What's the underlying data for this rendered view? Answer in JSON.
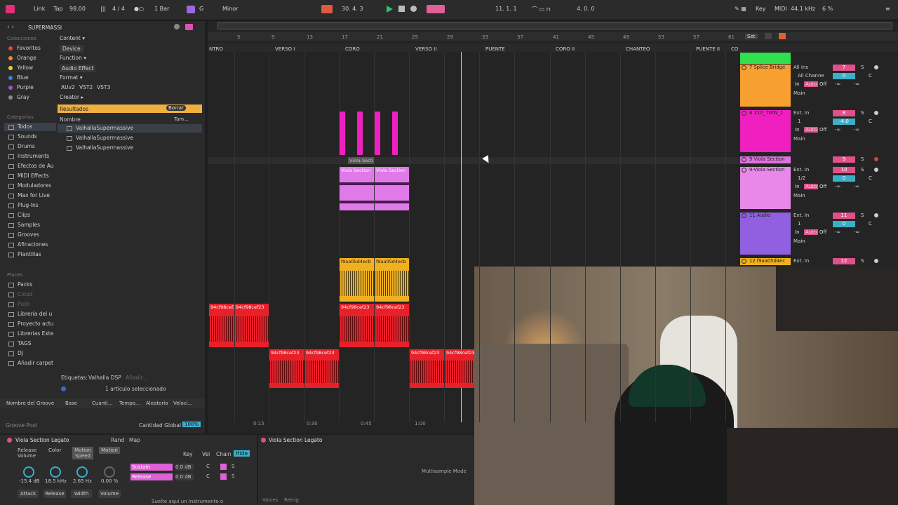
{
  "topbar": {
    "link": "Link",
    "tap": "Tap",
    "tempo": "98.00",
    "signature": "4 / 4",
    "quant": "1 Bar",
    "key_root": "G",
    "scale": "Minor",
    "pos1": "30.  4.  3",
    "pos2": "11.  1.  1",
    "pos3": "4.  0.  0",
    "key_btn": "Key",
    "midi_btn": "MIDI",
    "sample_rate": "44.1 kHz",
    "cpu": "6 %"
  },
  "browser": {
    "search": "SUPERMASSI",
    "colecciones_title": "Colecciones",
    "collections": [
      {
        "label": "Favoritos",
        "color": "#e04545"
      },
      {
        "label": "Orange",
        "color": "#f08a2a"
      },
      {
        "label": "Yellow",
        "color": "#e8d430"
      },
      {
        "label": "Blue",
        "color": "#3f7fe0"
      },
      {
        "label": "Purple",
        "color": "#9a55d8"
      },
      {
        "label": "Gray",
        "color": "#8a8a8a"
      }
    ],
    "categorias_title": "Categorías",
    "categories": [
      "Todos",
      "Sounds",
      "Drums",
      "Instruments",
      "Efectos de Au",
      "MIDI Effects",
      "Moduladores",
      "Max for Live",
      "Plug-Ins",
      "Clips",
      "Samples",
      "Grooves",
      "Afinaciones",
      "Plantillas"
    ],
    "places_title": "Places",
    "places": [
      "Packs",
      "Cloud",
      "Push",
      "Librería del u",
      "Proyecto actu",
      "Librerias Exte",
      "TAGS",
      "DJ",
      "Añadir carpet"
    ],
    "filters": {
      "content": "Content ▾",
      "device": "Device",
      "function": "Function ▾",
      "audio_effect": "Audio Effect",
      "format": "Format ▾",
      "formats": [
        "AUv2",
        "VST2",
        "VST3"
      ],
      "creator": "Creator ▸"
    },
    "results_label": "Resultados",
    "clear_btn": "Borrar",
    "col_name": "Nombre",
    "col_size": "Tam...",
    "results": [
      "ValhallaSupermassive",
      "ValhallaSupermassive",
      "ValhallaSupermassive"
    ],
    "tags_label": "Etiquetas:",
    "tag_value": "Valhalla DSP",
    "add_tag": "Añadir...",
    "selected_info": "1 artículo seleccionado",
    "groove_headers": [
      "Nombre del Groove",
      "Base",
      "Cuanti...",
      "Tempo...",
      "Aleatorio",
      "Veloci..."
    ],
    "groove_pool": "Groove Pool",
    "global_amount_label": "Cantidad Global",
    "global_amount": "100%"
  },
  "arrangement": {
    "ruler": [
      "5",
      "9",
      "13",
      "17",
      "21",
      "25",
      "29",
      "33",
      "37",
      "41",
      "45",
      "49",
      "53",
      "57",
      "61"
    ],
    "locators": [
      "NTRO",
      "VERSO I",
      "CORO",
      "VERSO II",
      "PUENTE",
      "CORO II",
      "CHANTEO",
      "PUENTE II",
      "CO"
    ],
    "set_label": "Set",
    "timeline": [
      "0:15",
      "0:30",
      "0:45",
      "1:00"
    ],
    "clip_labels": {
      "viola_small": "Viola Secti",
      "viola_1": "Viola Section",
      "viola_2": "Viola Section",
      "yellow_1": "f9aa05d4ecb",
      "yellow_2": "f9aa05d4ecb",
      "red_a1": "94cf98cef23",
      "red_a2": "94cf98cef23",
      "red_b1": "94cf98cef23",
      "red_b2": "94cf98cef23",
      "red_c1": "94cf98cef23",
      "red_c2": "94cf98cef23",
      "red_d1": "94cf98cef23",
      "red_d2": "94cf98cef23"
    },
    "tracks": [
      {
        "name": "7 Splice Bridge",
        "color": "#f7a030",
        "in": "All Ins",
        "ch": "All Channe",
        "num": "7",
        "out": "Main",
        "vol": "0",
        "pan": "C"
      },
      {
        "name": "8 X10_TWW_1",
        "color": "#f020c0",
        "in": "Ext. In",
        "ch": "1",
        "num": "8",
        "out": "Main",
        "vol": "-4.0",
        "pan": "C"
      },
      {
        "name": "9 Viola Section",
        "color": "#e070e0",
        "in": "",
        "ch": "",
        "num": "9",
        "out": "",
        "vol": "",
        "pan": ""
      },
      {
        "name": "9-Viola Section",
        "color": "#e888e8",
        "in": "Ext. In",
        "ch": "1/2",
        "num": "10",
        "out": "Main",
        "vol": "0",
        "pan": "C"
      },
      {
        "name": "11 Audio",
        "color": "#9060e0",
        "in": "Ext. In",
        "ch": "1",
        "num": "11",
        "out": "Main",
        "vol": "0",
        "pan": "C"
      },
      {
        "name": "12 f9aa05d4ec",
        "color": "#f0b020",
        "in": "Ext. In",
        "ch": "",
        "num": "12",
        "out": "",
        "vol": "",
        "pan": ""
      }
    ],
    "mon_in": "In",
    "mon_auto": "Auto",
    "mon_off": "Off",
    "send": "-∞"
  },
  "device": {
    "title": "Viola Section Legato",
    "rand": "Rand",
    "map": "Map",
    "tabs": [
      "Release Volume",
      "Color",
      "Motion Speed",
      "Motion"
    ],
    "key": "Key",
    "vel": "Vel",
    "chain": "Chain",
    "hide": "Hide",
    "knob_values": [
      "-15.4 dB",
      "18.5 kHz",
      "2.65 Hz",
      "0.00 %"
    ],
    "chains": [
      {
        "name": "Sustain",
        "vol": "0.0 dB",
        "pan": "C"
      },
      {
        "name": "Release",
        "vol": "0.0 dB",
        "pan": "C"
      }
    ],
    "bottom_tabs": [
      "Attack",
      "Release",
      "Width",
      "Volume"
    ],
    "drop_hint": "Suelte aquí un Instrumento o"
  },
  "sampler": {
    "title": "Viola Section Legato",
    "mode": "Multisample Mode",
    "voices": "Voices",
    "retrig": "Retrig"
  },
  "colors": {
    "accent": "#f07a2a",
    "clip_pink": "#f020c0",
    "clip_viola": "#e07ae8",
    "clip_yellow": "#f0b020",
    "clip_red": "#e8202a",
    "results_bar": "#f0b040"
  }
}
